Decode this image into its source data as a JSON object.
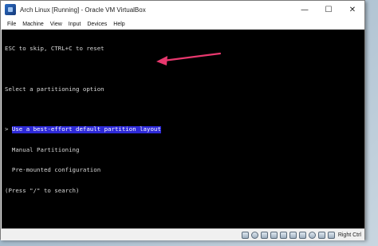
{
  "window": {
    "title": "Arch Linux [Running] - Oracle VM VirtualBox",
    "controls": {
      "minimize": "—",
      "maximize": "☐",
      "close": "✕"
    }
  },
  "menubar": {
    "items": [
      "File",
      "Machine",
      "View",
      "Input",
      "Devices",
      "Help"
    ]
  },
  "console": {
    "hint": "ESC to skip, CTRL+C to reset",
    "heading": "Select a partitioning option",
    "marker": ">",
    "options": [
      "Use a best-effort default partition layout",
      "Manual Partitioning",
      "Pre-mounted configuration"
    ],
    "search_hint": "(Press \"/\" to search)",
    "selected_index": 0
  },
  "statusbar": {
    "host_key_label": "Right Ctrl",
    "icons": [
      "hard-disk-icon",
      "optical-drive-icon",
      "audio-icon",
      "network-icon",
      "usb-icon",
      "shared-folders-icon",
      "display-icon",
      "video-capture-icon",
      "mouse-integration-icon",
      "keyboard-icon"
    ]
  },
  "annotation": {
    "arrow_color": "#e8386e"
  },
  "colors": {
    "console_bg": "#000000",
    "console_fg": "#d8d8d8",
    "selection_bg": "#2e2ad8"
  }
}
